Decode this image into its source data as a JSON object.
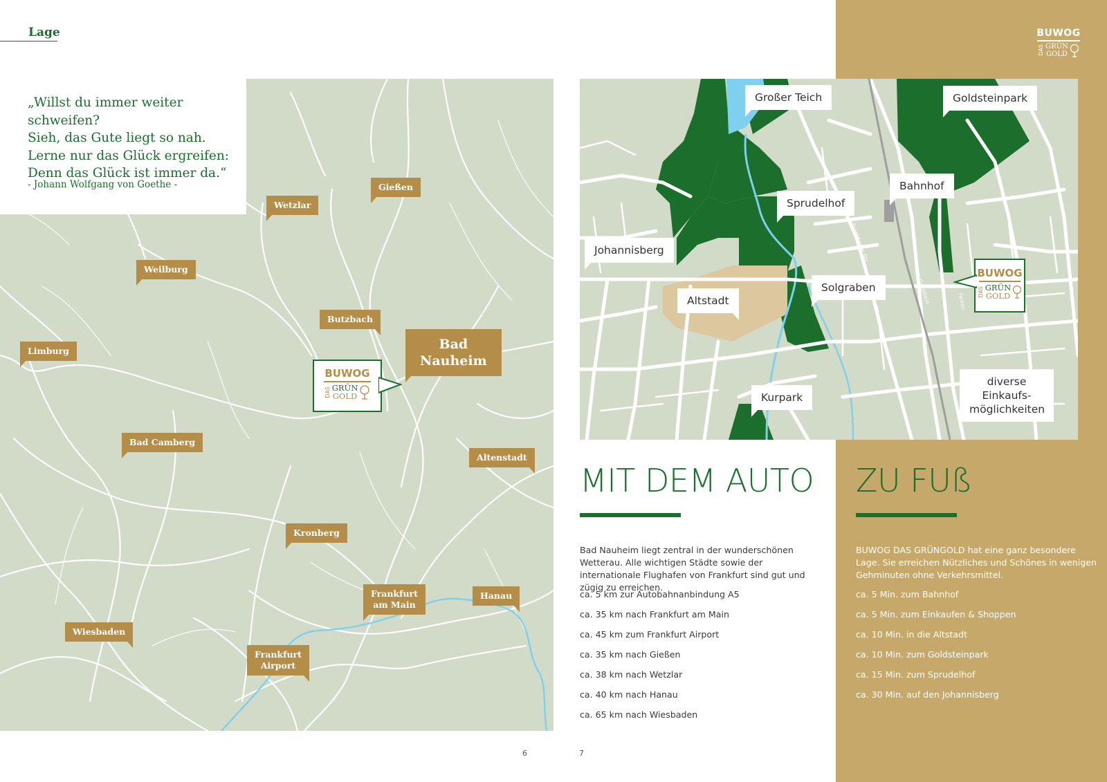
{
  "section": {
    "title": "Lage"
  },
  "quote": {
    "lines": [
      "„Willst du immer weiter schweifen?",
      "Sieh, das Gute liegt so nah.",
      "Lerne nur das Glück ergreifen:",
      "Denn das Glück ist immer da.“"
    ],
    "author": "- Johann Wolfgang von Goethe -"
  },
  "region_map": {
    "towns": {
      "giessen": "Gießen",
      "wetzlar": "Wetzlar",
      "weilburg": "Weilburg",
      "butzbach": "Butzbach",
      "limburg": "Limburg",
      "bad_nauheim_1": "Bad",
      "bad_nauheim_2": "Nauheim",
      "bad_camberg": "Bad Camberg",
      "altenstadt": "Altenstadt",
      "kronberg": "Kronberg",
      "frankfurt_1": "Frankfurt",
      "frankfurt_2": "am Main",
      "hanau": "Hanau",
      "wiesbaden": "Wiesbaden",
      "airport_1": "Frankfurt",
      "airport_2": "Airport"
    }
  },
  "logo": {
    "brand": "BUWOG",
    "das": "DAS",
    "gruen": "GRÜN",
    "gold": "GOLD"
  },
  "city_map": {
    "places": {
      "grosser_teich": "Großer Teich",
      "goldsteinpark": "Goldsteinpark",
      "bahnhof": "Bahnhof",
      "sprudelhof": "Sprudelhof",
      "johannisberg": "Johannisberg",
      "solgraben": "Solgraben",
      "altstadt": "Altstadt",
      "kurpark": "Kurpark",
      "shops_1": "diverse",
      "shops_2": "Einkaufs-",
      "shops_3": "möglichkeiten"
    },
    "streets": {
      "s1": "Frankfurter Str.",
      "s2": "Am Goldstein",
      "s3": "Parkstr."
    }
  },
  "car": {
    "heading": "MIT DEM AUTO",
    "intro": "Bad Nauheim liegt zentral in der wunderschönen Wetterau. Alle wichtigen Städte sowie der internationale Flughafen von Frankfurt sind gut und zügig zu erreichen.",
    "items": [
      "ca. 5 km zur Autobahnanbindung A5",
      "ca. 35 km nach Frankfurt am Main",
      "ca. 45 km zum Frankfurt Airport",
      "ca. 35 km nach Gießen",
      "ca. 38 km nach Wetzlar",
      "ca. 40 km nach Hanau",
      "ca. 65 km nach Wiesbaden"
    ]
  },
  "foot": {
    "heading": "ZU FUß",
    "intro": "BUWOG DAS GRÜNGOLD hat eine ganz besondere Lage. Sie erreichen Nützliches und Schönes in wenigen Gehminuten ohne Verkehrsmittel.",
    "items": [
      "ca. 5 Min. zum Bahnhof",
      "ca. 5 Min. zum Einkaufen & Shoppen",
      "ca. 10 Min. in die Altstadt",
      "ca. 10 Min. zum Goldsteinpark",
      "ca. 15 Min. zum Sprudelhof",
      "ca. 30 Min. auf den Johannisberg"
    ]
  },
  "pages": {
    "left": "6",
    "right": "7"
  },
  "colors": {
    "green": "#1b6e2c",
    "gold": "#c6a86a",
    "tag_gold": "#b48e49",
    "map_bg": "#d1dbc8",
    "water": "#7fd0ee",
    "altstadt": "#dcc79f"
  }
}
